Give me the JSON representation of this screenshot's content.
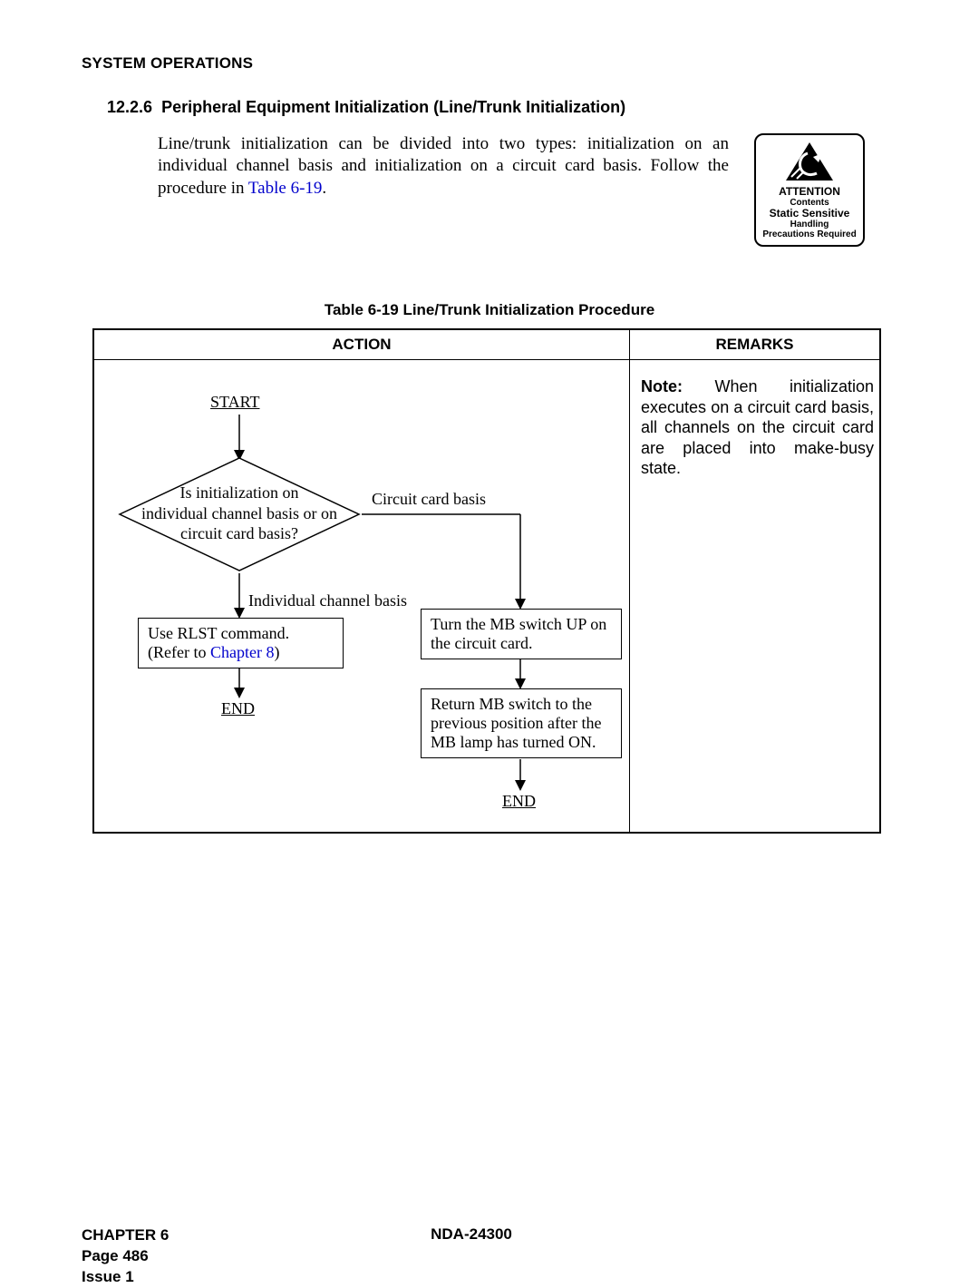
{
  "header": {
    "title": "SYSTEM OPERATIONS"
  },
  "section": {
    "number": "12.2.6",
    "title": "Peripheral Equipment Initialization (Line/Trunk Initialization)"
  },
  "paragraph": {
    "part1": "Line/trunk initialization can be divided into two types: initialization on an individual channel basis and initialization on a circuit card basis. Follow the procedure in ",
    "link": "Table 6-19",
    "part2": "."
  },
  "attention": {
    "line1": "ATTENTION",
    "line2": "Contents",
    "line3": "Static Sensitive",
    "line4": "Handling",
    "line5": "Precautions Required"
  },
  "table": {
    "caption": "Table 6-19  Line/Trunk Initialization Procedure",
    "headers": {
      "action": "ACTION",
      "remarks": "REMARKS"
    },
    "remarks": {
      "label": "Note:",
      "text": "  When initialization executes on a circuit card basis, all channels on the circuit card are placed into make-busy state."
    }
  },
  "flow": {
    "start": "START",
    "decision": "Is initialization on\nindividual channel basis or on\ncircuit card basis?",
    "branch_right": "Circuit card basis",
    "branch_down": "Individual channel basis",
    "left_box_pre": "Use RLST command.\n(Refer to ",
    "left_box_link": "Chapter 8",
    "left_box_post": ")",
    "end1": "END",
    "right_box1": "Turn the MB switch UP on the circuit card.",
    "right_box2": "Return MB switch to the previous position after the MB lamp has turned ON.",
    "end2": "END"
  },
  "footer": {
    "chapter": "CHAPTER 6",
    "page": "Page 486",
    "issue": "Issue 1",
    "doc": "NDA-24300"
  }
}
